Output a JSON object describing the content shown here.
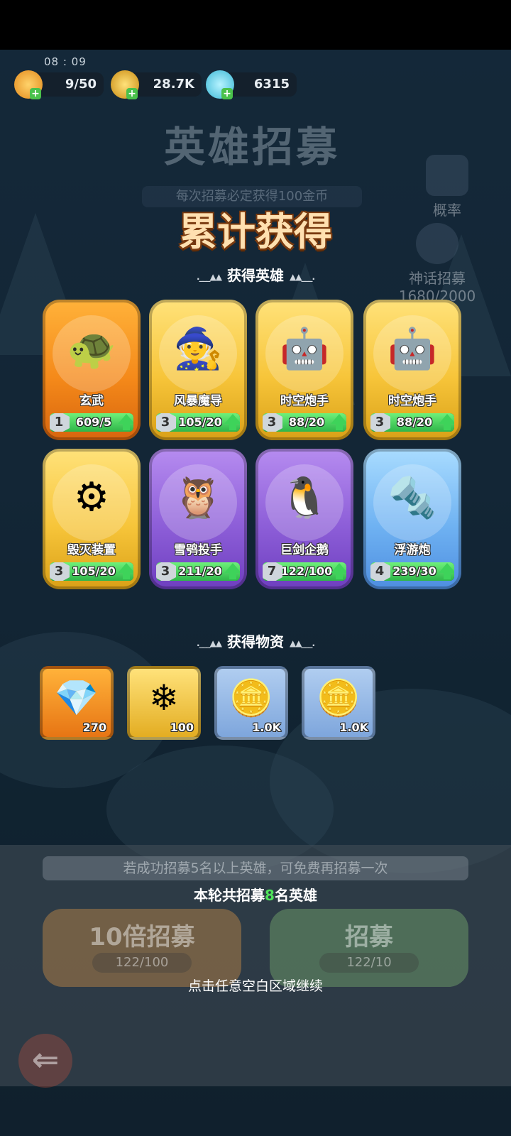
{
  "status": {
    "time": "08 : 09",
    "resources": [
      {
        "name": "stamina",
        "value": "9/50",
        "icon": "flame-icon",
        "color": "#f5a623"
      },
      {
        "name": "gold",
        "value": "28.7K",
        "icon": "coin-icon",
        "color": "#e8b21f"
      },
      {
        "name": "crystal",
        "value": "6315",
        "icon": "snowflake-crystal-icon",
        "color": "#58d6e8"
      }
    ]
  },
  "background": {
    "title": "英雄招募",
    "subtitle": "每次招募必定获得100金币",
    "probability_label": "概率",
    "myth_label": "神话招募",
    "myth_progress": "1680/2000"
  },
  "overlay": {
    "title": "累计获得",
    "heroes_heading": "获得英雄",
    "items_heading": "获得物资",
    "heroes": [
      {
        "name": "玄武",
        "level": "1",
        "progress": "609/5",
        "fill": 1.0,
        "rarity": "orange",
        "glyph": "🐢"
      },
      {
        "name": "风暴魔导",
        "level": "3",
        "progress": "105/20",
        "fill": 1.0,
        "rarity": "gold",
        "glyph": "🧙"
      },
      {
        "name": "时空炮手",
        "level": "3",
        "progress": "88/20",
        "fill": 1.0,
        "rarity": "gold",
        "glyph": "🤖"
      },
      {
        "name": "时空炮手",
        "level": "3",
        "progress": "88/20",
        "fill": 1.0,
        "rarity": "gold",
        "glyph": "🤖"
      },
      {
        "name": "毁灭装置",
        "level": "3",
        "progress": "105/20",
        "fill": 1.0,
        "rarity": "gold",
        "glyph": "⚙"
      },
      {
        "name": "雪鸮投手",
        "level": "3",
        "progress": "211/20",
        "fill": 1.0,
        "rarity": "purple",
        "glyph": "🦉"
      },
      {
        "name": "巨剑企鹅",
        "level": "7",
        "progress": "122/100",
        "fill": 1.0,
        "rarity": "purple",
        "glyph": "🐧"
      },
      {
        "name": "浮游炮",
        "level": "4",
        "progress": "239/30",
        "fill": 1.0,
        "rarity": "blue",
        "glyph": "🔩"
      }
    ],
    "items": [
      {
        "count": "270",
        "rarity": "orange",
        "glyph": "💎",
        "icon": "amber-crystal-icon"
      },
      {
        "count": "100",
        "rarity": "gold",
        "glyph": "❄",
        "icon": "snowflake-crystal-icon"
      },
      {
        "count": "1.0K",
        "rarity": "blue",
        "glyph": "🪙",
        "icon": "coin-icon"
      },
      {
        "count": "1.0K",
        "rarity": "blue",
        "glyph": "🪙",
        "icon": "coin-icon"
      }
    ]
  },
  "bottom": {
    "hint": "若成功招募5名以上英雄，可免费再招募一次",
    "round_prefix": "本轮共招募",
    "round_count": "8",
    "round_suffix": "名英雄",
    "btn10_label": "10倍招募",
    "btn10_cost": "122/100",
    "btn1_label": "招募",
    "btn1_cost": "122/10",
    "continue_text": "点击任意空白区域继续",
    "back_icon": "back-arrow-icon"
  }
}
